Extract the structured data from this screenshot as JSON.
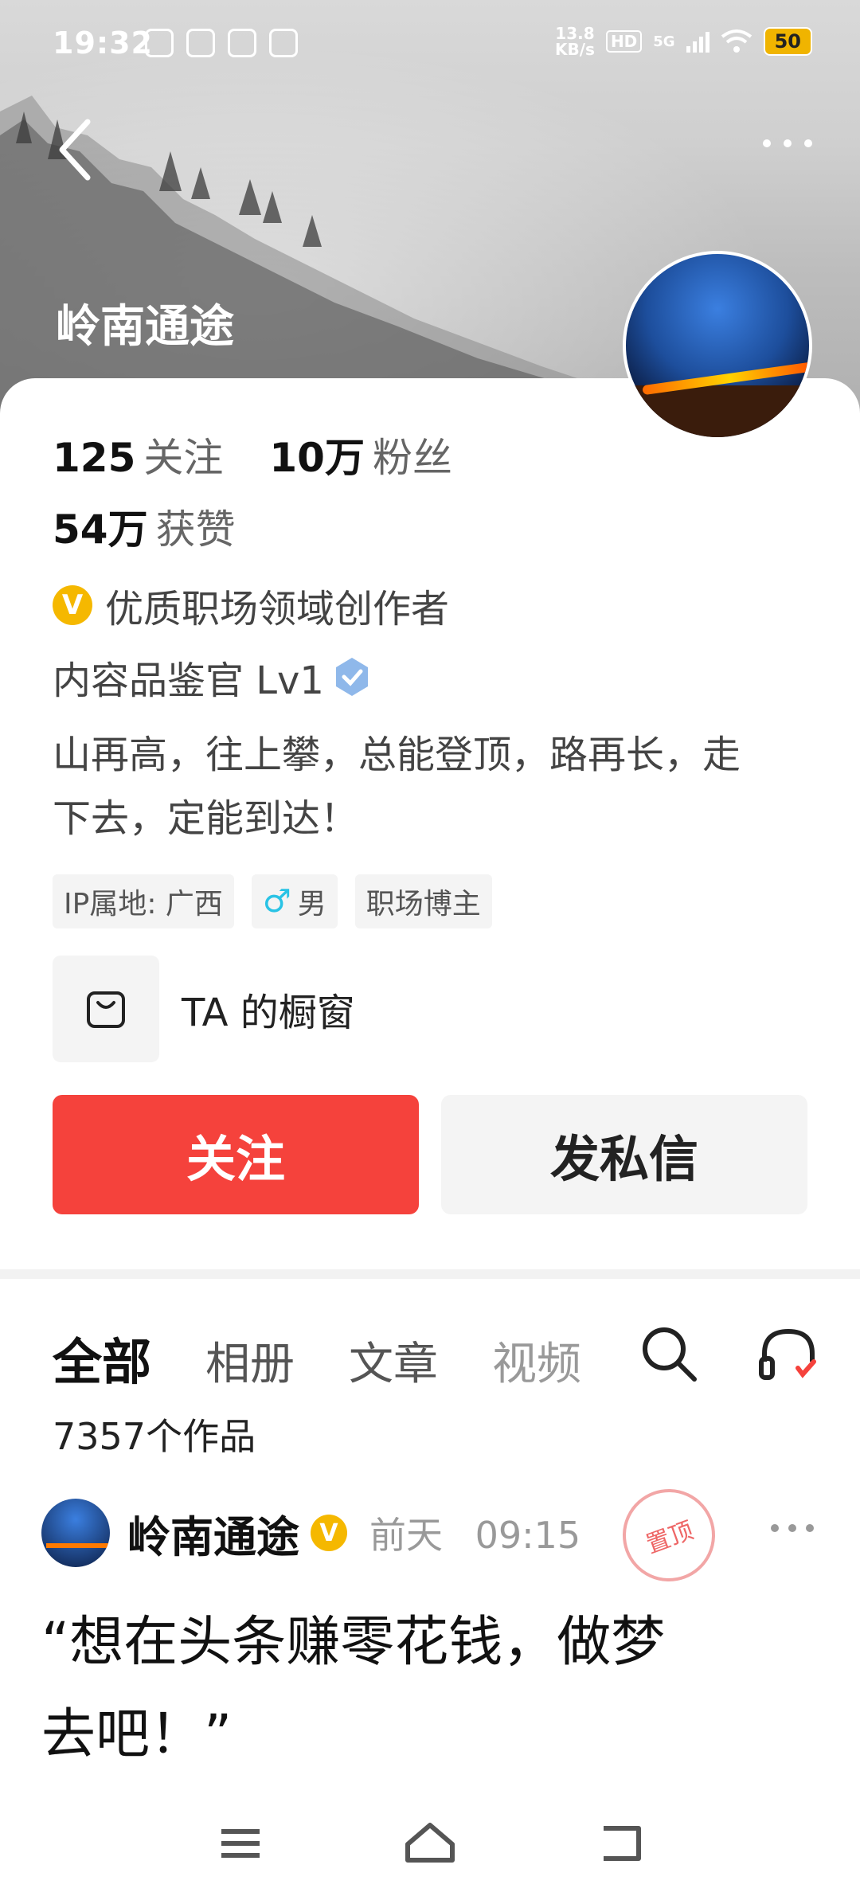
{
  "status_bar": {
    "time": "19:32",
    "net_speed_value": "13.8",
    "net_speed_unit": "KB/s",
    "hd": "HD",
    "network": "5G",
    "battery": "50"
  },
  "profile": {
    "name": "岭南通途",
    "following_count": "125",
    "following_label": "关注",
    "followers_count": "10万",
    "followers_label": "粉丝",
    "likes_count": "54万",
    "likes_label": "获赞",
    "creator_badge_letter": "V",
    "creator_badge": "优质职场领域创作者",
    "level": "内容品鉴官 Lv1",
    "bio_line1": "山再高，往上攀，总能登顶，路再长，走",
    "bio_line2": "下去，定能到达！",
    "tags": {
      "ip": "IP属地: 广西",
      "gender_symbol": "♂",
      "gender": "男",
      "category": "职场博主"
    },
    "shop_label": "TA 的橱窗"
  },
  "actions": {
    "follow": "关注",
    "message": "发私信"
  },
  "tabs": {
    "all": "全部",
    "album": "相册",
    "article": "文章",
    "video": "视频"
  },
  "works_count": "7357个作品",
  "post": {
    "author": "岭南通途",
    "v_letter": "V",
    "time_day": "前天",
    "time_clock": "09:15",
    "pin_label": "置顶",
    "title_line1": "“想在头条赚零花钱，做梦",
    "title_line2": "去吧！”"
  },
  "colors": {
    "accent": "#f5423c",
    "verified_gold": "#f5b800",
    "verified_blue": "#6fa3e0"
  }
}
